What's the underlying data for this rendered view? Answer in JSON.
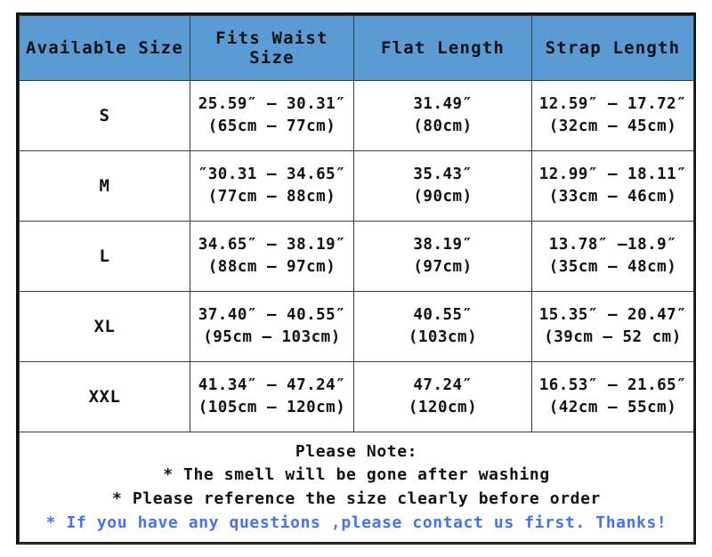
{
  "table": {
    "headers": [
      "Available Size",
      "Fits Waist Size",
      "Flat Length",
      "Strap Length"
    ],
    "rows": [
      {
        "size": "S",
        "waist_in": "25.59″ – 30.31″",
        "waist_cm": "(65cm – 77cm)",
        "flat_in": "31.49″",
        "flat_cm": "(80cm)",
        "strap_in": "12.59″ – 17.72″",
        "strap_cm": "(32cm – 45cm)"
      },
      {
        "size": "M",
        "waist_in": "″30.31 – 34.65″",
        "waist_cm": "(77cm – 88cm)",
        "flat_in": "35.43″",
        "flat_cm": "(90cm)",
        "strap_in": "12.99″ – 18.11″",
        "strap_cm": "(33cm – 46cm)"
      },
      {
        "size": "L",
        "waist_in": "34.65″ – 38.19″",
        "waist_cm": "(88cm – 97cm)",
        "flat_in": "38.19″",
        "flat_cm": "(97cm)",
        "strap_in": "13.78″ –18.9″",
        "strap_cm": "(35cm – 48cm)"
      },
      {
        "size": "XL",
        "waist_in": "37.40″ – 40.55″",
        "waist_cm": "(95cm – 103cm)",
        "flat_in": "40.55″",
        "flat_cm": "(103cm)",
        "strap_in": "15.35″ – 20.47″",
        "strap_cm": "(39cm – 52 cm)"
      },
      {
        "size": "XXL",
        "waist_in": "41.34″ – 47.24″",
        "waist_cm": "(105cm – 120cm)",
        "flat_in": "47.24″",
        "flat_cm": "(120cm)",
        "strap_in": "16.53″ – 21.65″",
        "strap_cm": "(42cm – 55cm)"
      }
    ]
  },
  "notes": {
    "title": "Please Note:",
    "line1": "* The smell will be gone after washing",
    "line2": "* Please reference the size clearly before order",
    "line3": "* If you have any questions ,please contact us first. Thanks!"
  },
  "colors": {
    "header_blue": "#5B9BD5",
    "note_blue": "#4472f0",
    "border": "#3a3a3a",
    "outer_border": "#111111",
    "text": "#111111"
  }
}
